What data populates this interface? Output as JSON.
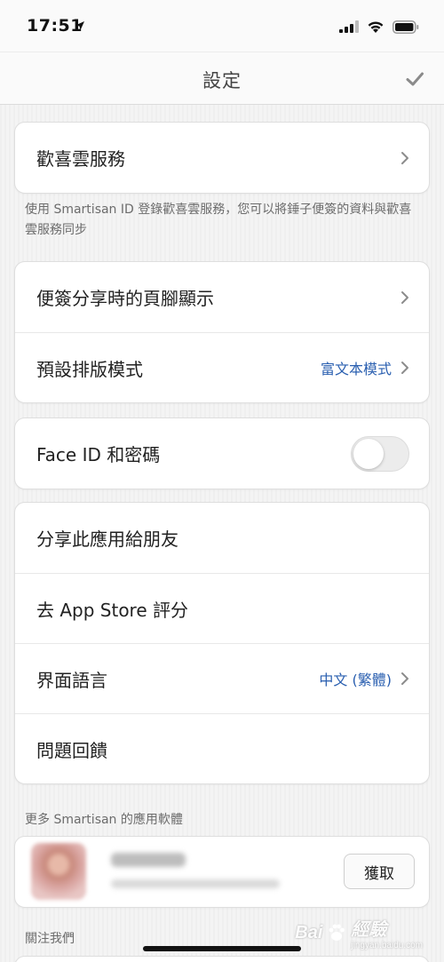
{
  "status_bar": {
    "time": "17:51"
  },
  "nav": {
    "title": "設定"
  },
  "sections": {
    "cloud": {
      "label": "歡喜雲服務",
      "caption": "使用 Smartisan ID 登錄歡喜雲服務，您可以將錘子便簽的資料與歡喜雲服務同步"
    },
    "notes": {
      "footer_label": "便簽分享時的頁腳顯示",
      "layout_label": "預設排版模式",
      "layout_value": "富文本模式"
    },
    "security": {
      "faceid_label": "Face ID 和密碼",
      "faceid_enabled": false
    },
    "general": {
      "share_label": "分享此應用給朋友",
      "rate_label": "去 App Store 評分",
      "language_label": "界面語言",
      "language_value": "中文 (繁體)",
      "feedback_label": "問題回饋"
    },
    "more_apps": {
      "header": "更多 Smartisan 的應用軟體",
      "get_label": "獲取"
    },
    "follow": {
      "header": "關注我們"
    }
  },
  "watermark": {
    "brand": "Bai",
    "brand_tail": "經驗",
    "url": "jingyan.baidu.com"
  },
  "colors": {
    "accent_blue": "#2a5fb0",
    "background": "#f4f4f4",
    "card": "#ffffff"
  }
}
